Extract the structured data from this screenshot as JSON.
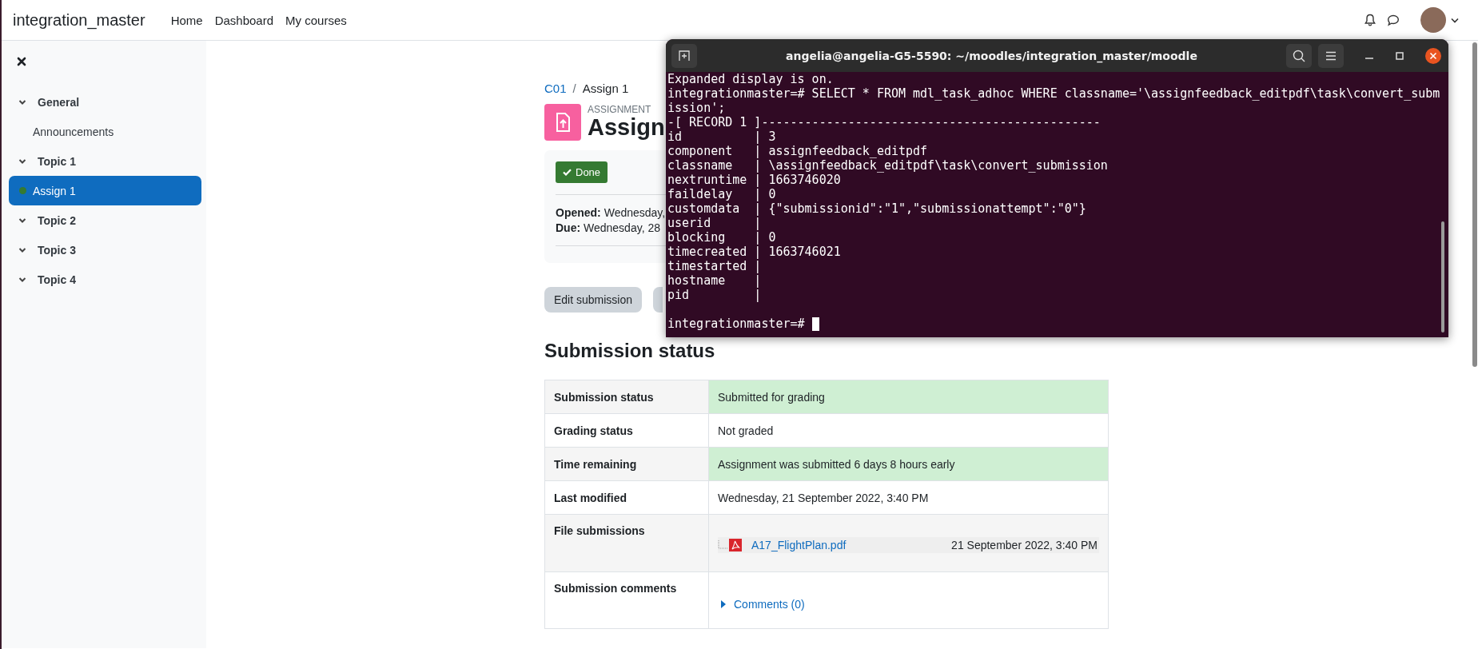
{
  "navbar": {
    "brand": "integration_master",
    "links": [
      "Home",
      "Dashboard",
      "My courses"
    ]
  },
  "sidebar": {
    "items": [
      {
        "label": "General",
        "expanded": true,
        "children": [
          {
            "label": "Announcements",
            "selected": false,
            "completed": false
          }
        ]
      },
      {
        "label": "Topic 1",
        "expanded": true,
        "children": [
          {
            "label": "Assign 1",
            "selected": true,
            "completed": true
          }
        ]
      },
      {
        "label": "Topic 2",
        "expanded": true
      },
      {
        "label": "Topic 3",
        "expanded": true
      },
      {
        "label": "Topic 4",
        "expanded": true
      }
    ]
  },
  "breadcrumb_separator": "/",
  "breadcrumb": [
    {
      "label": "C01",
      "link": true
    },
    {
      "label": "Assign 1",
      "link": false
    }
  ],
  "activity": {
    "type_label": "ASSIGNMENT",
    "title": "Assign"
  },
  "completion": {
    "label": "Done",
    "done": true
  },
  "dates": [
    "**Opened:** Wednesday,",
    "**Due:** Wednesday, 28"
  ],
  "buttons": [
    "Edit submission"
  ],
  "section_title": "Submission status",
  "table": {
    "rows": [
      {
        "kind": "text",
        "label": "Submission status",
        "value": "Submitted for grading",
        "highlight": true
      },
      {
        "kind": "text",
        "label": "Grading status",
        "value": "Not graded",
        "highlight": false
      },
      {
        "kind": "text",
        "label": "Time remaining",
        "value": "Assignment was submitted 6 days 8 hours early",
        "highlight": true
      },
      {
        "kind": "text",
        "label": "Last modified",
        "value": "Wednesday, 21 September 2022, 3:40 PM",
        "highlight": false
      },
      {
        "kind": "file",
        "label": "File submissions",
        "file": "A17_FlightPlan.pdf",
        "date": "21 September 2022, 3:40 PM",
        "highlight": false
      },
      {
        "kind": "comments",
        "label": "Submission comments",
        "link": "Comments (0)",
        "highlight": false
      }
    ]
  },
  "terminal": {
    "title": "angelia@angelia-G5-5590: ~/moodles/integration_master/moodle",
    "lines": [
      "Expanded display is on.",
      "integrationmaster=# SELECT * FROM mdl_task_adhoc WHERE classname='\\assignfeedback_editpdf\\task\\convert_subm",
      "ission';",
      "-[ RECORD 1 ]-----------------------------------------------",
      "id          | 3",
      "component   | assignfeedback_editpdf",
      "classname   | \\assignfeedback_editpdf\\task\\convert_submission",
      "nextruntime | 1663746020",
      "faildelay   | 0",
      "customdata  | {\"submissionid\":\"1\",\"submissionattempt\":\"0\"}",
      "userid      |",
      "blocking    | 0",
      "timecreated | 1663746021",
      "timestarted |",
      "hostname    |",
      "pid         |"
    ],
    "prompt": "integrationmaster=# "
  }
}
